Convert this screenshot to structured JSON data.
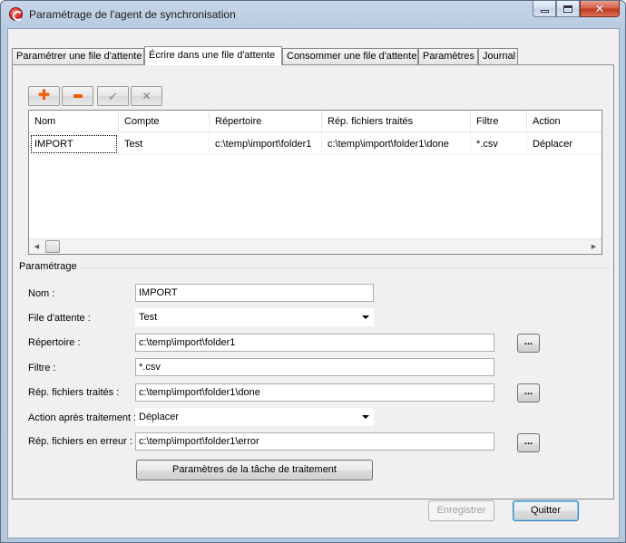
{
  "window": {
    "title": "Paramétrage de l'agent de synchronisation",
    "buttons": {
      "minimize": "minimize-icon",
      "maximize": "maximize-icon",
      "close": "close-icon"
    }
  },
  "tabs": [
    {
      "label": "Paramétrer une file d'attente",
      "active": false
    },
    {
      "label": "Écrire dans une file d'attente",
      "active": true
    },
    {
      "label": "Consommer une file d'attente",
      "active": false
    },
    {
      "label": "Paramètres",
      "active": false
    },
    {
      "label": "Journal",
      "active": false
    }
  ],
  "toolbar": {
    "add": {
      "icon": "plus-icon",
      "color": "#f05a00"
    },
    "remove": {
      "icon": "minus-icon",
      "color": "#f05a00"
    },
    "validate": {
      "icon": "check-icon",
      "enabled": false
    },
    "cancel": {
      "icon": "cross-icon",
      "enabled": false
    }
  },
  "grid": {
    "columns": [
      "Nom",
      "Compte",
      "Répertoire",
      "Rép. fichiers traités",
      "Filtre",
      "Action"
    ],
    "rows": [
      [
        "IMPORT",
        "Test",
        "c:\\temp\\import\\folder1",
        "c:\\temp\\import\\folder1\\done",
        "*.csv",
        "Déplacer"
      ]
    ]
  },
  "settings": {
    "group_label": "Paramétrage",
    "nom": {
      "label": "Nom :",
      "value": "IMPORT"
    },
    "file_attente": {
      "label": "File d'attente :",
      "value": "Test"
    },
    "repertoire": {
      "label": "Répertoire :",
      "value": "c:\\temp\\import\\folder1",
      "browse": "..."
    },
    "filtre": {
      "label": "Filtre :",
      "value": "*.csv"
    },
    "rep_traites": {
      "label": "Rép. fichiers traités :",
      "value": "c:\\temp\\import\\folder1\\done",
      "browse": "..."
    },
    "action": {
      "label": "Action après traitement :",
      "value": "Déplacer"
    },
    "rep_erreur": {
      "label": "Rép. fichiers en erreur :",
      "value": "c:\\temp\\import\\folder1\\error",
      "browse": "..."
    },
    "task_button": "Paramètres de la tâche de traitement"
  },
  "footer": {
    "save": {
      "label": "Enregistrer",
      "enabled": false
    },
    "quit": {
      "label": "Quitter",
      "enabled": true
    }
  }
}
